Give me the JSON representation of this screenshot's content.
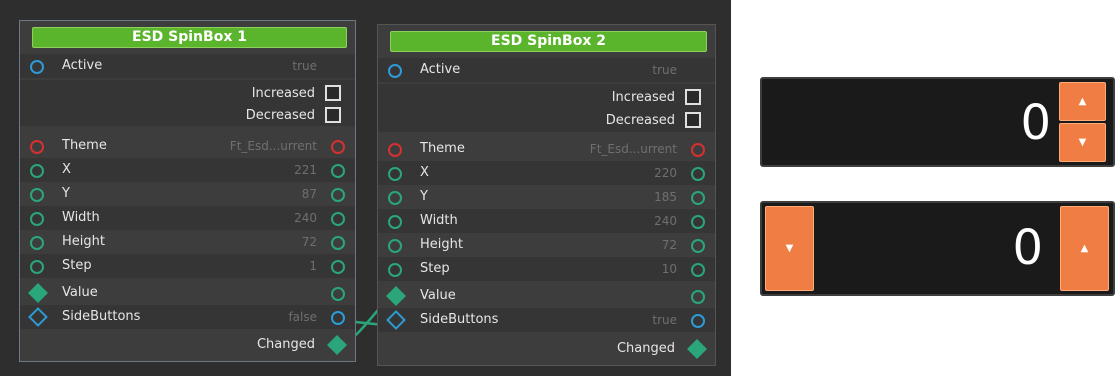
{
  "node1": {
    "title": "ESD SpinBox 1",
    "active": {
      "label": "Active",
      "value": "true"
    },
    "increased": "Increased",
    "decreased": "Decreased",
    "theme": {
      "label": "Theme",
      "value": "Ft_Esd...urrent"
    },
    "x": {
      "label": "X",
      "value": "221"
    },
    "y": {
      "label": "Y",
      "value": "87"
    },
    "width": {
      "label": "Width",
      "value": "240"
    },
    "height": {
      "label": "Height",
      "value": "72"
    },
    "step": {
      "label": "Step",
      "value": "1"
    },
    "value": {
      "label": "Value"
    },
    "sidebuttons": {
      "label": "SideButtons",
      "value": "false"
    },
    "changed": "Changed"
  },
  "node2": {
    "title": "ESD SpinBox 2",
    "active": {
      "label": "Active",
      "value": "true"
    },
    "increased": "Increased",
    "decreased": "Decreased",
    "theme": {
      "label": "Theme",
      "value": "Ft_Esd...urrent"
    },
    "x": {
      "label": "X",
      "value": "220"
    },
    "y": {
      "label": "Y",
      "value": "185"
    },
    "width": {
      "label": "Width",
      "value": "240"
    },
    "height": {
      "label": "Height",
      "value": "72"
    },
    "step": {
      "label": "Step",
      "value": "10"
    },
    "value": {
      "label": "Value"
    },
    "sidebuttons": {
      "label": "SideButtons",
      "value": "true"
    },
    "changed": "Changed"
  },
  "preview": {
    "spin1": {
      "value": "0",
      "up": "▲",
      "down": "▼"
    },
    "spin2": {
      "value": "0",
      "up": "▲",
      "down": "▼"
    }
  },
  "colors": {
    "accent": "#5ab52c",
    "wire": "#2aa67a",
    "spin_button": "#f07e44"
  }
}
